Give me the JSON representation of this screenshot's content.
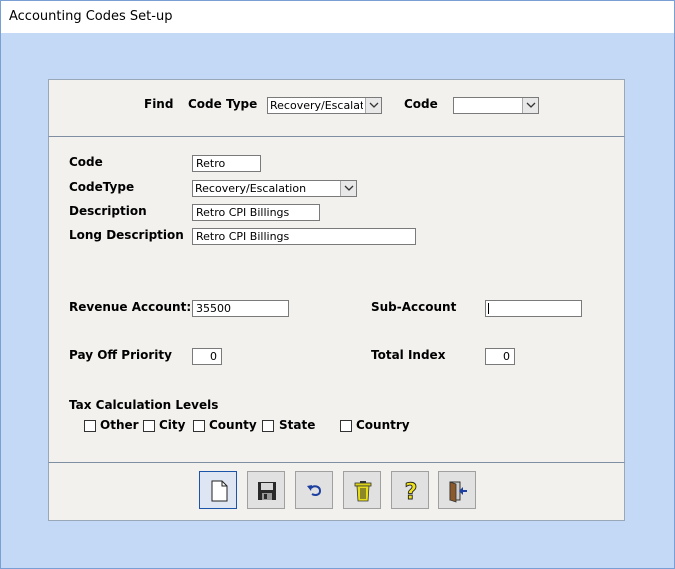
{
  "window": {
    "title": "Accounting Codes Set-up"
  },
  "find": {
    "label": "Find",
    "code_type_label": "Code Type",
    "code_type_value": "Recovery/Escalation",
    "code_label": "Code",
    "code_value": ""
  },
  "form": {
    "code_label": "Code",
    "code_value": "Retro",
    "codetype_label": "CodeType",
    "codetype_value": "Recovery/Escalation",
    "description_label": "Description",
    "description_value": "Retro CPI Billings",
    "long_description_label": "Long Description",
    "long_description_value": "Retro CPI Billings",
    "revenue_account_label": "Revenue Account:",
    "revenue_account_value": "35500",
    "sub_account_label": "Sub-Account",
    "sub_account_value": "",
    "pay_off_priority_label": "Pay Off Priority",
    "pay_off_priority_value": "0",
    "total_index_label": "Total Index",
    "total_index_value": "0",
    "tax_levels_label": "Tax Calculation Levels",
    "tax_levels": [
      {
        "label": "Other",
        "checked": false
      },
      {
        "label": "City",
        "checked": false
      },
      {
        "label": "County",
        "checked": false
      },
      {
        "label": "State",
        "checked": false
      },
      {
        "label": "Country",
        "checked": false
      }
    ]
  },
  "toolbar": {
    "buttons": [
      {
        "icon": "new-document-icon"
      },
      {
        "icon": "save-icon"
      },
      {
        "icon": "undo-icon"
      },
      {
        "icon": "trash-icon"
      },
      {
        "icon": "help-icon"
      },
      {
        "icon": "exit-icon"
      }
    ]
  },
  "colors": {
    "background": "#c3d9f6",
    "panel": "#f2f1ee",
    "focus_border": "#1b54a8"
  }
}
